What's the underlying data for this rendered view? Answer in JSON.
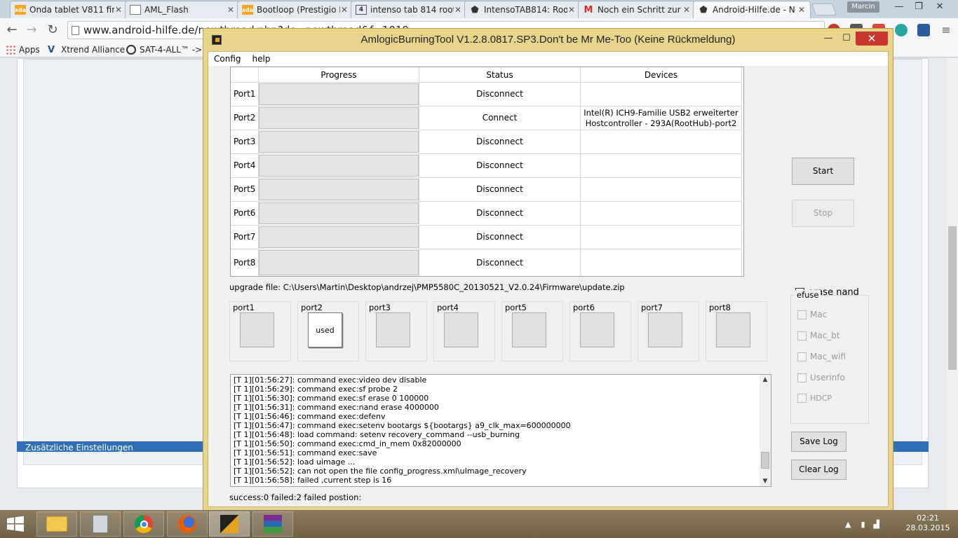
{
  "browser": {
    "tabs": [
      {
        "title": "Onda tablet V811 fir",
        "icon": "xda-icon"
      },
      {
        "title": "AML_Flash",
        "icon": "document-icon"
      },
      {
        "title": "Bootloop (Prestigio I",
        "icon": "xda-icon"
      },
      {
        "title": "intenso tab 814 root",
        "icon": "number-4-icon"
      },
      {
        "title": "IntensoTAB814: Roo",
        "icon": "android-icon"
      },
      {
        "title": "Noch ein Schritt zur",
        "icon": "gmail-icon"
      },
      {
        "title": "Android-Hilfe.de - N",
        "icon": "android-icon"
      }
    ],
    "user": "Marcin",
    "url": "www.android-hilfe.de/newthread.php?do=newthread&f=1019",
    "bookmarks": [
      {
        "label": "Apps"
      },
      {
        "label": "Xtrend Alliance"
      },
      {
        "label": "SAT-4-ALL™ -> E"
      }
    ],
    "page_strip_text": "Zusätzliche Einstellungen"
  },
  "app": {
    "title": "AmlogicBurningTool  V1.2.8.0817.SP3.Don't be Mr Me-Too (Keine Rückmeldung)",
    "menu": [
      "Config",
      "help"
    ],
    "table": {
      "headers": {
        "progress": "Progress",
        "status": "Status",
        "devices": "Devices"
      },
      "rows": [
        {
          "port": "Port1",
          "status": "Disconnect",
          "device": "",
          "progress": 0
        },
        {
          "port": "Port2",
          "status": "Connect",
          "device": "Intel(R) ICH9-Familie USB2 erweiterter Hostcontroller - 293A(RootHub)-port2",
          "progress": 0
        },
        {
          "port": "Port3",
          "status": "Disconnect",
          "device": "",
          "progress": 0
        },
        {
          "port": "Port4",
          "status": "Disconnect",
          "device": "",
          "progress": 0
        },
        {
          "port": "Port5",
          "status": "Disconnect",
          "device": "",
          "progress": 0
        },
        {
          "port": "Port6",
          "status": "Disconnect",
          "device": "",
          "progress": 0
        },
        {
          "port": "Port7",
          "status": "Disconnect",
          "device": "",
          "progress": 0
        },
        {
          "port": "Port8",
          "status": "Disconnect",
          "device": "",
          "progress": 0
        }
      ]
    },
    "upgrade_file": "upgrade file: C:\\Users\\Martin\\Desktop\\andrzej\\PMP5580C_20130521_V2.0.24\\Firmware\\update.zip",
    "slots": [
      {
        "label": "port1",
        "button": ""
      },
      {
        "label": "port2",
        "button": "used"
      },
      {
        "label": "port3",
        "button": ""
      },
      {
        "label": "port4",
        "button": ""
      },
      {
        "label": "port5",
        "button": ""
      },
      {
        "label": "port6",
        "button": ""
      },
      {
        "label": "port7",
        "button": ""
      },
      {
        "label": "port8",
        "button": ""
      }
    ],
    "log": [
      "[T 1][01:56:27]: command exec:video dev disable",
      "[T 1][01:56:29]: command exec:sf probe 2",
      "[T 1][01:56:30]: command exec:sf erase 0 100000",
      "[T 1][01:56:31]: command exec:nand erase 4000000",
      "[T 1][01:56:46]: command exec:defenv",
      "[T 1][01:56:47]: command exec:setenv bootargs ${bootargs} a9_clk_max=600000000",
      "[T 1][01:56:48]: load command: setenv recovery_command --usb_burning",
      "[T 1][01:56:50]: command exec:cmd_in_mem 0x82000000",
      "[T 1][01:56:51]: command exec:save",
      "[T 1][01:56:52]: load uimage ...",
      "[T 1][01:56:52]: can not open the file config_progress.xml\\uImage_recovery",
      "[T 1][01:56:58]: failed ,current step is 16"
    ],
    "summary": "success:0 failed:2 failed postion:",
    "buttons": {
      "start": "Start",
      "stop": "Stop",
      "save_log": "Save Log",
      "clear_log": "Clear Log"
    },
    "erase_nand": "erase nand",
    "efuse": {
      "title": "efuse",
      "items": [
        "Mac",
        "Mac_bt",
        "Mac_wifi",
        "Userinfo",
        "HDCP"
      ]
    }
  },
  "taskbar": {
    "time": "02:21",
    "date": "28.03.2015"
  }
}
